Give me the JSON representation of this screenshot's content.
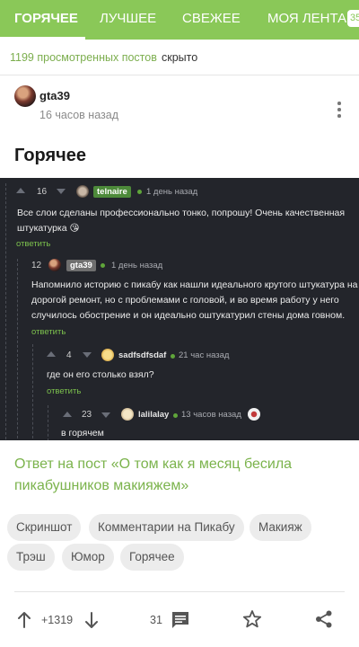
{
  "tabs": [
    {
      "label": "ГОРЯЧЕЕ",
      "active": true
    },
    {
      "label": "ЛУЧШЕЕ",
      "active": false
    },
    {
      "label": "СВЕЖЕЕ",
      "active": false
    },
    {
      "label": "МОЯ ЛЕНТА",
      "active": false
    }
  ],
  "tab_badge": "35",
  "hidden_posts": {
    "count_text": "1199 просмотренных постов",
    "hidden_text": "скрыто"
  },
  "author": {
    "name": "gta39",
    "time": "16 часов назад",
    "avatar_icon": "user-avatar"
  },
  "post": {
    "title": "Горячее"
  },
  "screenshot": {
    "comments": [
      {
        "score": "16",
        "user": "telnaire",
        "time": "1 день назад",
        "text_lines": [
          "Все слои сделаны профессионально тонко, попрошу! Очень качественная",
          "штукатурка 😘"
        ],
        "reply": "ответить"
      },
      {
        "score": "12",
        "user": "gta39",
        "time": "1 день назад",
        "text_lines": [
          "Напомнило историю с пикабу как нашли идеального крутого штукатура на",
          "дорогой ремонт, но с проблемами с головой, и во время работу у него",
          "случилось обострение и он идеально оштукатурил стены дома говном."
        ],
        "reply": "ответить"
      },
      {
        "score": "4",
        "user": "sadfsdfsdaf",
        "time": "21 час назад",
        "text_lines": [
          "где он его столько взял?"
        ],
        "reply": "ответить"
      },
      {
        "score": "23",
        "user": "lalilalay",
        "time": "13 часов назад",
        "text_lines": [
          "в горячем"
        ],
        "reply": ""
      }
    ]
  },
  "answer_link": "Ответ на пост «О том как я месяц бесила пикабушников макияжем»",
  "tags": [
    "Скриншот",
    "Комментарии на Пикабу",
    "Макияж",
    "Трэш",
    "Юмор",
    "Горячее"
  ],
  "actions": {
    "rating": "+1319",
    "comments_count": "31"
  },
  "colors": {
    "brand_green": "#8ac858",
    "link_green": "#7bb34c",
    "dark_bg": "#23252b"
  }
}
